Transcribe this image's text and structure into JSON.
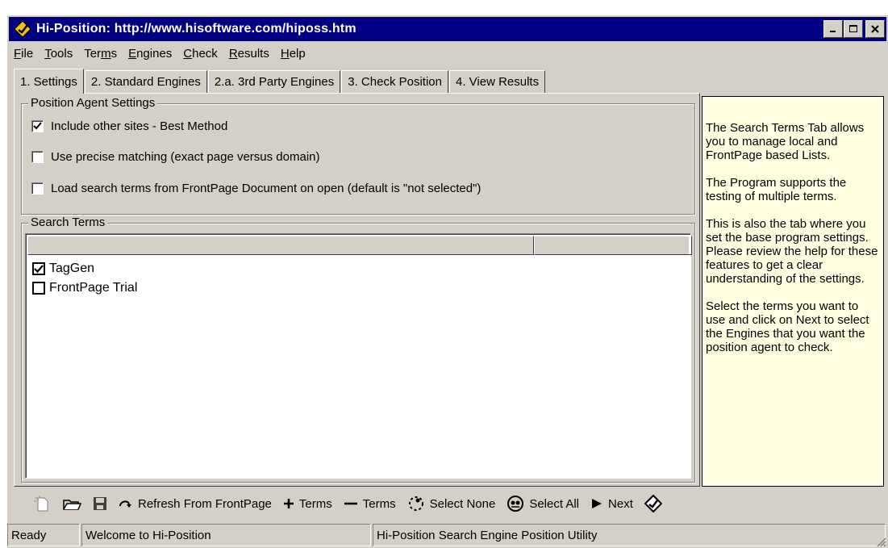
{
  "window": {
    "title": "Hi-Position: http://www.hisoftware.com/hiposs.htm"
  },
  "menu": [
    {
      "pre": "",
      "u": "F",
      "post": "ile"
    },
    {
      "pre": "",
      "u": "T",
      "post": "ools"
    },
    {
      "pre": "Ter",
      "u": "m",
      "post": "s"
    },
    {
      "pre": "",
      "u": "E",
      "post": "ngines"
    },
    {
      "pre": "",
      "u": "C",
      "post": "heck"
    },
    {
      "pre": "",
      "u": "R",
      "post": "esults"
    },
    {
      "pre": "",
      "u": "H",
      "post": "elp"
    }
  ],
  "tabs": [
    {
      "label": "1. Settings",
      "active": true
    },
    {
      "label": "2. Standard Engines",
      "active": false
    },
    {
      "label": "2.a. 3rd Party Engines",
      "active": false
    },
    {
      "label": "3. Check Position",
      "active": false
    },
    {
      "label": "4. View Results",
      "active": false
    }
  ],
  "settings": {
    "group_label": "Position Agent Settings",
    "options": [
      {
        "label": "Include other sites - Best Method",
        "checked": true
      },
      {
        "label": "Use precise matching (exact page versus domain)",
        "checked": false
      },
      {
        "label": "Load search terms from FrontPage Document on open (default is \"not selected\")",
        "checked": false
      }
    ]
  },
  "terms": {
    "group_label": "Search Terms",
    "items": [
      {
        "label": "TagGen",
        "checked": true
      },
      {
        "label": "FrontPage Trial",
        "checked": false
      }
    ]
  },
  "help": {
    "paragraphs": [
      "The Search Terms Tab allows you to manage local and FrontPage based Lists.",
      "The Program supports the testing of multiple terms.",
      "This is also the tab where you set the base program settings. Please review the help for these features to get a clear understanding of the settings.",
      "Select the terms you want to use and click on Next to select the Engines that you want the position agent to check."
    ]
  },
  "toolbar": {
    "refresh_label": "Refresh From FrontPage",
    "add_terms_label": "Terms",
    "remove_terms_label": "Terms",
    "select_none_label": "Select None",
    "select_all_label": "Select All",
    "next_label": "Next"
  },
  "status": {
    "state": "Ready",
    "message": "Welcome to Hi-Position",
    "app": "Hi-Position Search Engine Position Utility"
  },
  "colors": {
    "title_bar": "#000080",
    "help_background": "#ffffe1",
    "face": "#d4d0c8"
  }
}
